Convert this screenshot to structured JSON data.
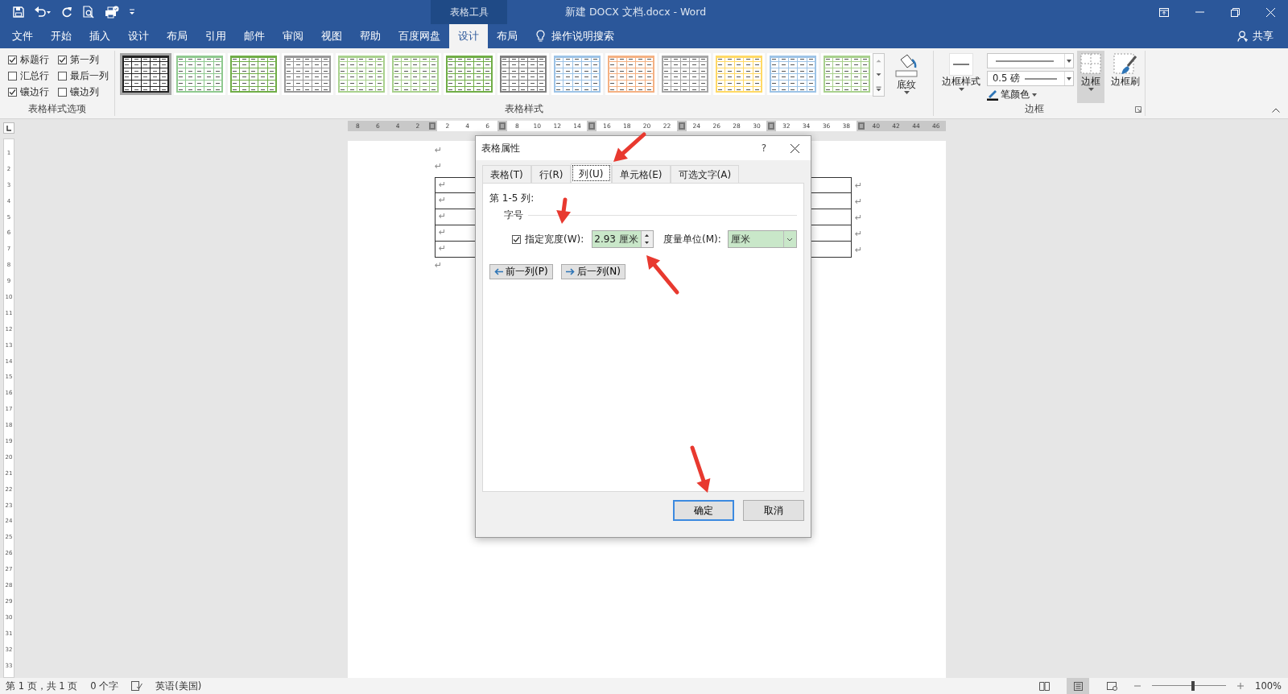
{
  "window": {
    "context_tab": "表格工具",
    "title": "新建 DOCX 文档.docx  -  Word"
  },
  "menu_tabs": [
    {
      "label": "文件",
      "selected": false
    },
    {
      "label": "开始",
      "selected": false
    },
    {
      "label": "插入",
      "selected": false
    },
    {
      "label": "设计",
      "selected": false
    },
    {
      "label": "布局",
      "selected": false
    },
    {
      "label": "引用",
      "selected": false
    },
    {
      "label": "邮件",
      "selected": false
    },
    {
      "label": "审阅",
      "selected": false
    },
    {
      "label": "视图",
      "selected": false
    },
    {
      "label": "帮助",
      "selected": false
    },
    {
      "label": "百度网盘",
      "selected": false
    },
    {
      "label": "设计",
      "selected": true
    },
    {
      "label": "布局",
      "selected": false
    }
  ],
  "tell_me": "操作说明搜索",
  "share": "共享",
  "ribbon": {
    "style_options": {
      "group": "表格样式选项",
      "items": [
        {
          "label": "标题行",
          "checked": true
        },
        {
          "label": "第一列",
          "checked": true
        },
        {
          "label": "汇总行",
          "checked": false
        },
        {
          "label": "最后一列",
          "checked": false
        },
        {
          "label": "镶边行",
          "checked": true
        },
        {
          "label": "镶边列",
          "checked": false
        }
      ]
    },
    "styles": {
      "group": "表格样式",
      "items": [
        {
          "selected": true,
          "color": "#222222"
        },
        {
          "selected": false,
          "color": "#8fc98f"
        },
        {
          "selected": false,
          "color": "#70ad47"
        },
        {
          "selected": false,
          "color": "#999999"
        },
        {
          "selected": false,
          "color": "#a9d18e"
        },
        {
          "selected": false,
          "color": "#a9d18e"
        },
        {
          "selected": false,
          "color": "#70ad47"
        },
        {
          "selected": false,
          "color": "#7f7f7f"
        },
        {
          "selected": false,
          "color": "#9dc3e6"
        },
        {
          "selected": false,
          "color": "#f4b183"
        },
        {
          "selected": false,
          "color": "#a6a6a6"
        },
        {
          "selected": false,
          "color": "#ffd966"
        },
        {
          "selected": false,
          "color": "#9dc3e6"
        },
        {
          "selected": false,
          "color": "#a9d18e"
        }
      ],
      "shading": "底纹"
    },
    "borders": {
      "group": "边框",
      "border_styles": "边框样式",
      "pen_weight": "0.5 磅",
      "pen_color": "笔颜色",
      "borders_button": {
        "label": "边框",
        "selected": true
      },
      "border_painter": "边框刷"
    }
  },
  "ruler": [
    {
      "kind": "number",
      "label": "8",
      "shaded": true
    },
    {
      "kind": "number",
      "label": "6",
      "shaded": true
    },
    {
      "kind": "number",
      "label": "4",
      "shaded": true
    },
    {
      "kind": "number",
      "label": "2",
      "shaded": true
    },
    {
      "kind": "marker"
    },
    {
      "kind": "number",
      "label": "2",
      "shaded": false
    },
    {
      "kind": "number",
      "label": "4",
      "shaded": false
    },
    {
      "kind": "number",
      "label": "6",
      "shaded": false
    },
    {
      "kind": "marker"
    },
    {
      "kind": "number",
      "label": "8",
      "shaded": false
    },
    {
      "kind": "number",
      "label": "10",
      "shaded": false
    },
    {
      "kind": "number",
      "label": "12",
      "shaded": false
    },
    {
      "kind": "number",
      "label": "14",
      "shaded": false
    },
    {
      "kind": "marker"
    },
    {
      "kind": "number",
      "label": "16",
      "shaded": false
    },
    {
      "kind": "number",
      "label": "18",
      "shaded": false
    },
    {
      "kind": "number",
      "label": "20",
      "shaded": false
    },
    {
      "kind": "number",
      "label": "22",
      "shaded": false
    },
    {
      "kind": "marker"
    },
    {
      "kind": "number",
      "label": "24",
      "shaded": false
    },
    {
      "kind": "number",
      "label": "26",
      "shaded": false
    },
    {
      "kind": "number",
      "label": "28",
      "shaded": false
    },
    {
      "kind": "number",
      "label": "30",
      "shaded": false
    },
    {
      "kind": "marker"
    },
    {
      "kind": "number",
      "label": "32",
      "shaded": false
    },
    {
      "kind": "number",
      "label": "34",
      "shaded": false
    },
    {
      "kind": "number",
      "label": "36",
      "shaded": false
    },
    {
      "kind": "number",
      "label": "38",
      "shaded": false
    },
    {
      "kind": "marker"
    },
    {
      "kind": "number",
      "label": "40",
      "shaded": true
    },
    {
      "kind": "number",
      "label": "42",
      "shaded": true
    },
    {
      "kind": "number",
      "label": "44",
      "shaded": true
    },
    {
      "kind": "number",
      "label": "46",
      "shaded": true
    }
  ],
  "vertical_ruler": [
    "1",
    "2",
    "3",
    "4",
    "5",
    "6",
    "7",
    "8",
    "9",
    "10",
    "11",
    "12",
    "13",
    "14",
    "15",
    "16",
    "17",
    "18",
    "19",
    "20",
    "21",
    "22",
    "23",
    "24",
    "25",
    "26",
    "27",
    "28",
    "29",
    "30",
    "31",
    "32",
    "33"
  ],
  "document": {
    "before": [
      "↵",
      "↵"
    ],
    "table_rows": [
      {
        "cell": "↵",
        "row_end": "↵"
      },
      {
        "cell": "↵",
        "row_end": "↵"
      },
      {
        "cell": "↵",
        "row_end": "↵"
      },
      {
        "cell": "↵",
        "row_end": "↵"
      },
      {
        "cell": "↵",
        "row_end": "↵"
      }
    ],
    "after": [
      "↵"
    ]
  },
  "dialog": {
    "title": "表格属性",
    "help": "?",
    "tabs": [
      {
        "label": "表格(T)",
        "selected": false
      },
      {
        "label": "行(R)",
        "selected": false
      },
      {
        "label": "列(U)",
        "selected": true
      },
      {
        "label": "单元格(E)",
        "selected": false
      },
      {
        "label": "可选文字(A)",
        "selected": false
      }
    ],
    "range_label": "第 1-5 列:",
    "group": "字号",
    "width_option": {
      "label": "指定宽度(W):",
      "checked": true
    },
    "width_value": "2.93 厘米",
    "unit_label": "度量单位(M):",
    "unit": "厘米",
    "prev": "前一列(P)",
    "next": "后一列(N)",
    "ok": "确定",
    "cancel": "取消"
  },
  "status_bar": {
    "items": [
      "第 1 页，共 1 页",
      "0 个字",
      "英语(美国)"
    ],
    "views": [
      {
        "selected": false
      },
      {
        "selected": true
      },
      {
        "selected": false
      }
    ],
    "zoom": {
      "level": 0.55,
      "label": "100%"
    }
  }
}
